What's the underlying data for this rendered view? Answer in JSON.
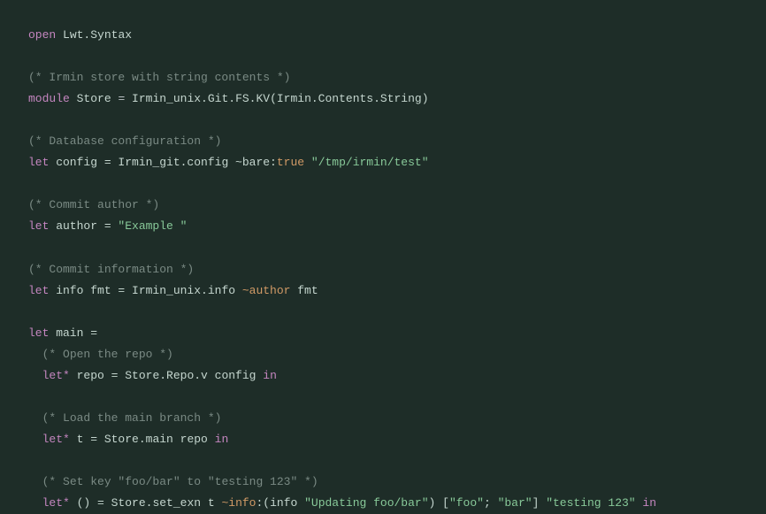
{
  "code": {
    "l1_open": "open",
    "l1_mod": "Lwt.Syntax",
    "l3_comment": "(* Irmin store with string contents *)",
    "l4_module": "module",
    "l4_name": "Store",
    "l4_eq": " = ",
    "l4_expr": "Irmin_unix.Git.FS.KV(Irmin.Contents.String)",
    "l6_comment": "(* Database configuration *)",
    "l7_let": "let",
    "l7_name": " config = Irmin_git.config ~bare:",
    "l7_bool": "true",
    "l7_str": "\"/tmp/irmin/test\"",
    "l9_comment": "(* Commit author *)",
    "l10_let": "let",
    "l10_rest": " author = ",
    "l10_str": "\"Example \"",
    "l12_comment": "(* Commit information *)",
    "l13_let": "let",
    "l13_mid": " info fmt = Irmin_unix.info ",
    "l13_label": "~author",
    "l13_end": " fmt",
    "l15_let": "let",
    "l15_rest": " main =",
    "l16_comment": "(* Open the repo *)",
    "l17_let": "let*",
    "l17_rest": " repo = Store.Repo.v config ",
    "l17_in": "in",
    "l19_comment": "(* Load the main branch *)",
    "l20_let": "let*",
    "l20_rest": " t = Store.main repo ",
    "l20_in": "in",
    "l22_comment": "(* Set key \"foo/bar\" to \"testing 123\" *)",
    "l23_let": "let*",
    "l23_a": " () = Store.set_exn t ",
    "l23_label": "~info",
    "l23_b": ":(info ",
    "l23_str1": "\"Updating foo/bar\"",
    "l23_c": ") [",
    "l23_str2": "\"foo\"",
    "l23_d": "; ",
    "l23_str3": "\"bar\"",
    "l23_e": "] ",
    "l23_str4": "\"testing 123\"",
    "l23_f": " ",
    "l23_in": "in"
  }
}
